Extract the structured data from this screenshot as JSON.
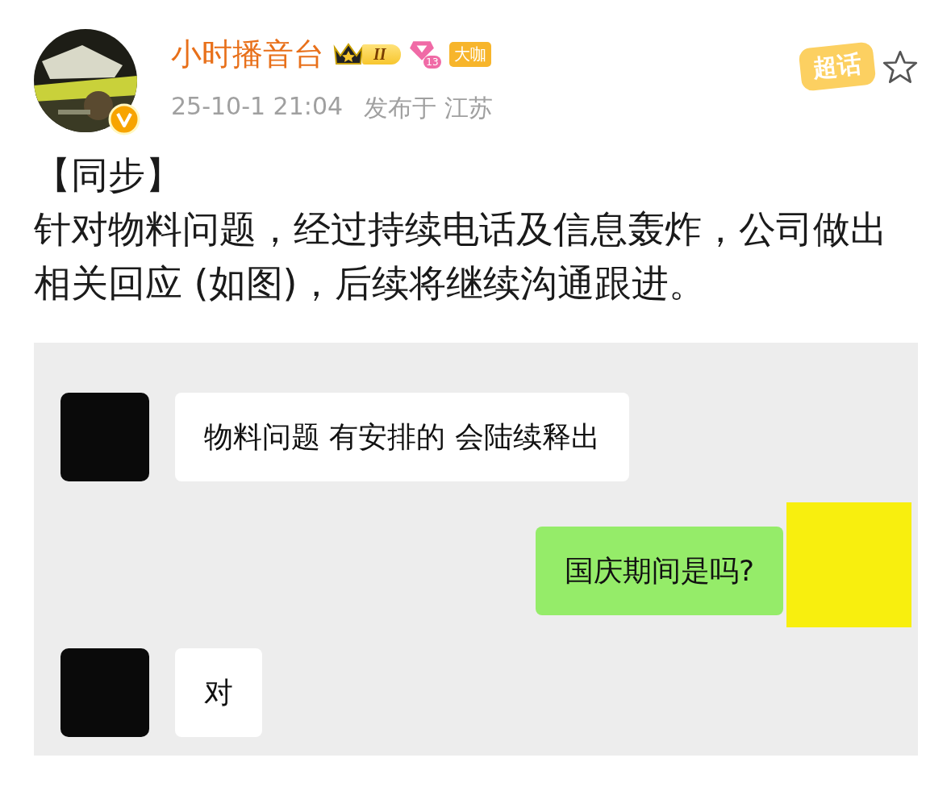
{
  "author": {
    "name": "小时播音台",
    "level_badge": "II",
    "gem_badge": "13",
    "tag_badge": "大咖",
    "verified": true
  },
  "topic_sticker": {
    "label": "超话"
  },
  "meta": {
    "time": "25-10-1 21:04",
    "location": "发布于 江苏"
  },
  "post": {
    "title": "【同步】",
    "text": "针对物料问题，经过持续电话及信息轰炸，公司做出相关回应 (如图)，后续将继续沟通跟进。"
  },
  "chat": [
    {
      "kind": "received",
      "text": "物料问题 有安排的 会陆续释出"
    },
    {
      "kind": "sent",
      "text": "国庆期间是吗?"
    },
    {
      "kind": "received",
      "text": "对"
    }
  ]
}
